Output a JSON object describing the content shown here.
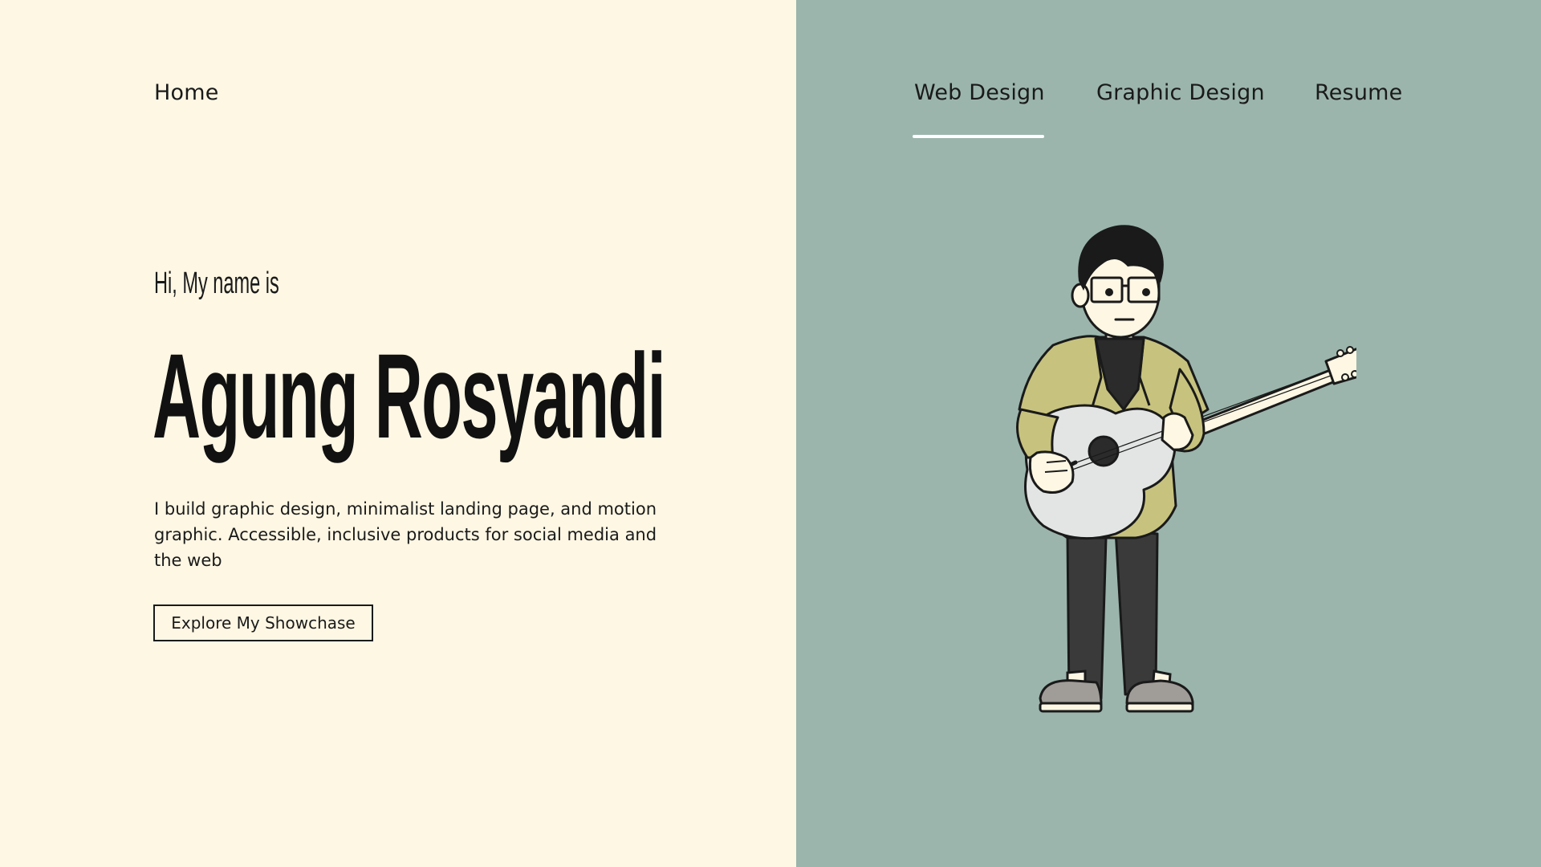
{
  "nav": {
    "home": "Home",
    "items": [
      {
        "label": "Web Design",
        "active": true
      },
      {
        "label": "Graphic Design",
        "active": false
      },
      {
        "label": "Resume",
        "active": false
      }
    ]
  },
  "hero": {
    "greeting": "Hi, My name is",
    "name": "Agung Rosyandi",
    "description": "I build graphic design, minimalist landing page, and motion graphic. Accessible, inclusive products for social media and the web",
    "cta_label": "Explore My Showchase"
  },
  "colors": {
    "left_background": "#FDF7E4",
    "right_background": "#9BB5AC",
    "text": "#1a1a1a",
    "active_underline": "#FFFFFF",
    "jacket": "#C7C37E",
    "guitar_body": "#E3E5E4",
    "pants": "#3A3A3A",
    "shoes": "#A09C98"
  },
  "illustration": {
    "icon": "guitar-player-illustration"
  }
}
